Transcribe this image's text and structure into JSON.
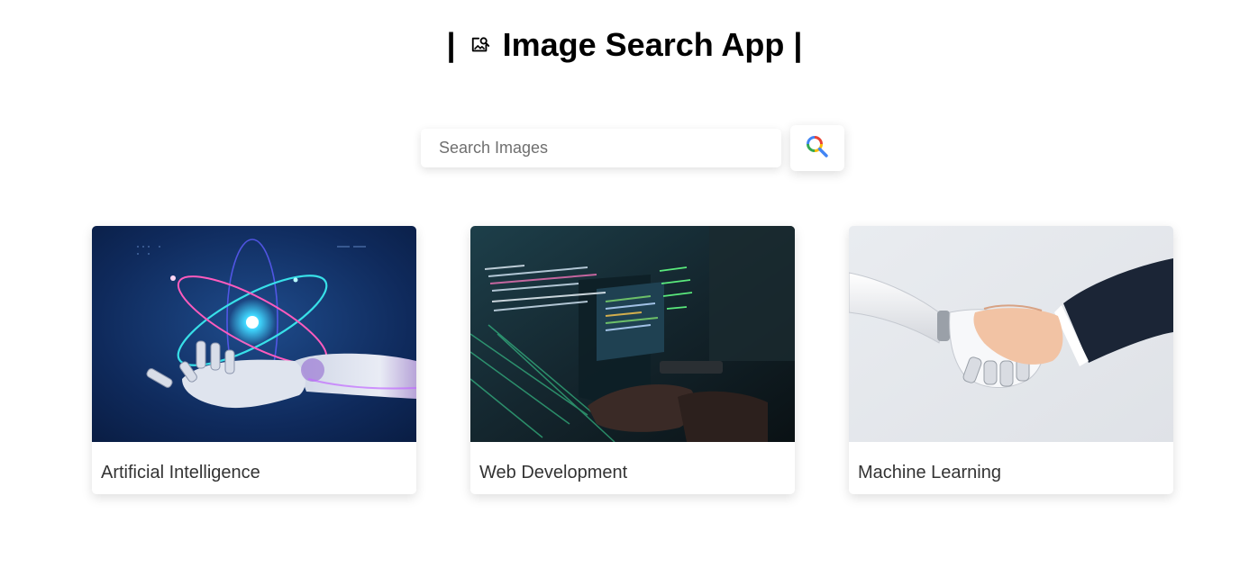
{
  "header": {
    "title_prefix": "|",
    "title_text": "Image Search App",
    "title_suffix": "|",
    "icon": "image-search-icon"
  },
  "search": {
    "placeholder": "Search Images",
    "value": "",
    "button_icon": "google-search-icon",
    "icon_colors": [
      "#4285F4",
      "#EA4335",
      "#FBBC05",
      "#34A853"
    ]
  },
  "results": [
    {
      "caption": "Artificial Intelligence",
      "image": "robot-hand-atom-photo"
    },
    {
      "caption": "Web Development",
      "image": "code-screen-typing-photo"
    },
    {
      "caption": "Machine Learning",
      "image": "robot-human-handshake-photo"
    }
  ]
}
